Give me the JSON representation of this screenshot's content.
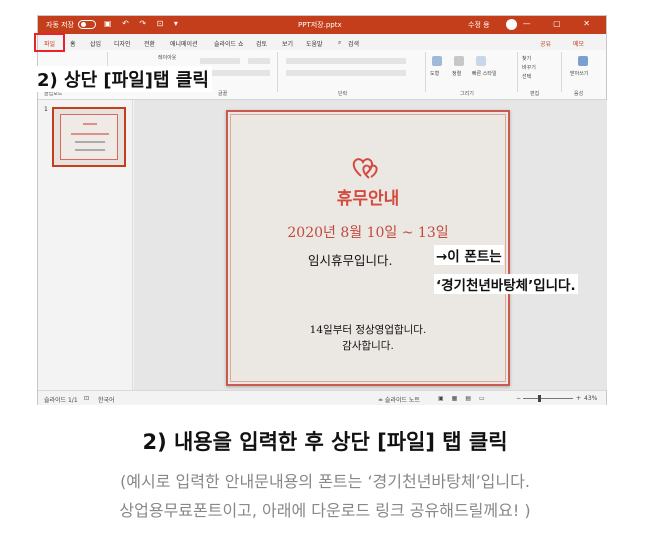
{
  "app": {
    "autosave_label": "자동 저장",
    "qat_icons": "▣ ↶ ↷ ⊡ ▾",
    "doc_title": "PPT저장.pptx",
    "user_name": "수정 용",
    "window_controls": "— ▢ ✕"
  },
  "tabs": [
    {
      "label": "파일"
    },
    {
      "label": "홈"
    },
    {
      "label": "삽입"
    },
    {
      "label": "디자인"
    },
    {
      "label": "전환"
    },
    {
      "label": "애니메이션"
    },
    {
      "label": "슬라이드 쇼"
    },
    {
      "label": "검토"
    },
    {
      "label": "보기"
    },
    {
      "label": "도움말"
    },
    {
      "label": "검색"
    }
  ],
  "tab_right": {
    "share": "공유",
    "memo": "메모"
  },
  "ribbon": {
    "groups": [
      "클립보드",
      "글꼴",
      "단락",
      "그리기",
      "편집",
      "음성"
    ],
    "layout_btn": "레이아웃",
    "buttons": [
      "도형",
      "정렬",
      "빠른 스타일",
      "찾기",
      "바꾸기",
      "선택",
      "받아쓰기"
    ]
  },
  "annotation": {
    "step_label": "2) 상단 [파일]탭 클릭",
    "arrow_note": "→이 폰트는",
    "font_note": "‘경기천년바탕체’입니다."
  },
  "thumbnail": {
    "number": "1"
  },
  "slide": {
    "title": "휴무안내",
    "date": "2020년 8월 10일 ~ 13일",
    "notice": "임시휴무입니다.",
    "body_line1": "14일부터 정상영업합니다.",
    "body_line2": "감사합니다."
  },
  "statusbar": {
    "slide_count": "슬라이드 1/1",
    "language": "한국어",
    "notes": "≐ 슬라이드 노트",
    "zoom": "43%"
  },
  "caption": {
    "title": "2) 내용을 입력한 후  상단 [파일] 탭 클릭",
    "line1": "(예시로 입력한 안내문내용의 폰트는 ‘경기천년바탕체’입니다.",
    "line2": "상업용무료폰트이고, 아래에 다운로드 링크 공유해드릴께요! )"
  },
  "colors": {
    "accent": "#c43e1c",
    "slide_red": "#d34b3f",
    "highlight": "#e8232c"
  }
}
